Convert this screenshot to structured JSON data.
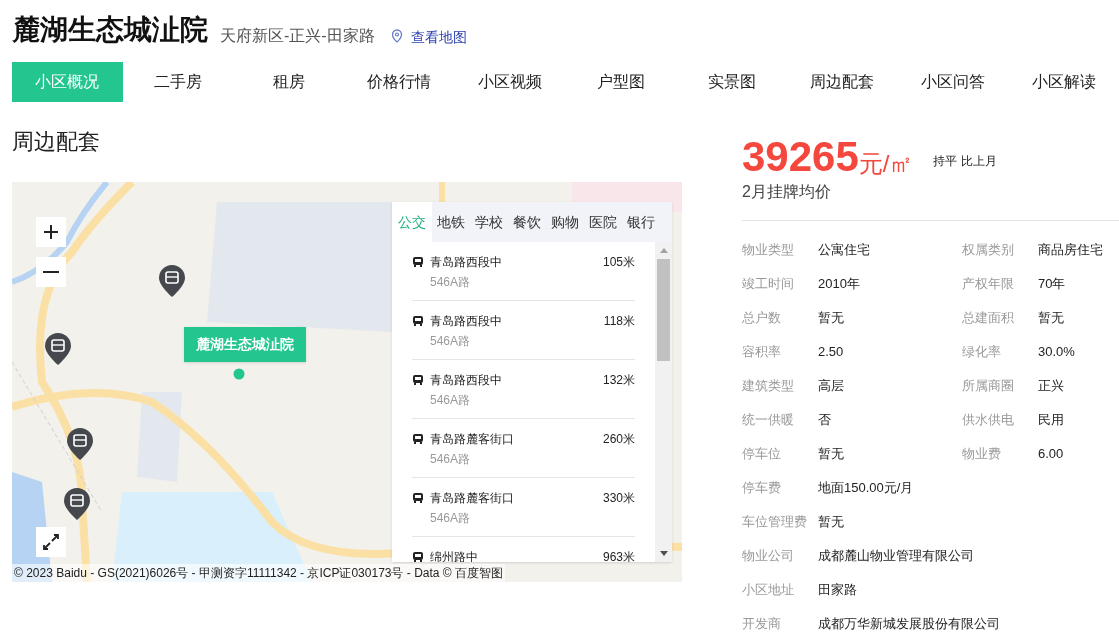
{
  "header": {
    "title": "麓湖生态城沚院",
    "location": "天府新区-正兴-田家路",
    "map_link": "查看地图"
  },
  "tabs": [
    {
      "label": "小区概况",
      "selected": true
    },
    {
      "label": "二手房",
      "selected": false
    },
    {
      "label": "租房",
      "selected": false
    },
    {
      "label": "价格行情",
      "selected": false
    },
    {
      "label": "小区视频",
      "selected": false
    },
    {
      "label": "户型图",
      "selected": false
    },
    {
      "label": "实景图",
      "selected": false
    },
    {
      "label": "周边配套",
      "selected": false
    },
    {
      "label": "小区问答",
      "selected": false
    },
    {
      "label": "小区解读",
      "selected": false
    }
  ],
  "section_title": "周边配套",
  "map": {
    "marker_label": "麓湖生态城沚院",
    "copyright": "© 2023 Baidu - GS(2021)6026号 - 甲测资字11111342 - 京ICP证030173号 - Data © 百度智图",
    "poi_tabs": [
      {
        "label": "公交",
        "selected": true
      },
      {
        "label": "地铁",
        "selected": false
      },
      {
        "label": "学校",
        "selected": false
      },
      {
        "label": "餐饮",
        "selected": false
      },
      {
        "label": "购物",
        "selected": false
      },
      {
        "label": "医院",
        "selected": false
      },
      {
        "label": "银行",
        "selected": false
      }
    ],
    "stops": [
      {
        "name": "青岛路西段中",
        "distance": "105米",
        "line": "546A路"
      },
      {
        "name": "青岛路西段中",
        "distance": "118米",
        "line": "546A路"
      },
      {
        "name": "青岛路西段中",
        "distance": "132米",
        "line": "546A路"
      },
      {
        "name": "青岛路麓客街口",
        "distance": "260米",
        "line": "546A路"
      },
      {
        "name": "青岛路麓客街口",
        "distance": "330米",
        "line": "546A路"
      },
      {
        "name": "绵州路中",
        "distance": "963米"
      }
    ]
  },
  "price": {
    "value": "39265",
    "unit": "元/㎡",
    "trend": "持平",
    "compare": "比上月",
    "caption": "2月挂牌均价"
  },
  "info": [
    [
      {
        "label": "物业类型",
        "value": "公寓住宅"
      },
      {
        "label": "权属类别",
        "value": "商品房住宅"
      }
    ],
    [
      {
        "label": "竣工时间",
        "value": "2010年"
      },
      {
        "label": "产权年限",
        "value": "70年"
      }
    ],
    [
      {
        "label": "总户数",
        "value": "暂无"
      },
      {
        "label": "总建面积",
        "value": "暂无"
      }
    ],
    [
      {
        "label": "容积率",
        "value": "2.50"
      },
      {
        "label": "绿化率",
        "value": "30.0%"
      }
    ],
    [
      {
        "label": "建筑类型",
        "value": "高层"
      },
      {
        "label": "所属商圈",
        "value": "正兴"
      }
    ],
    [
      {
        "label": "统一供暖",
        "value": "否"
      },
      {
        "label": "供水供电",
        "value": "民用"
      }
    ],
    [
      {
        "label": "停车位",
        "value": "暂无"
      },
      {
        "label": "物业费",
        "value": "6.00"
      }
    ],
    [
      {
        "label": "停车费",
        "value": "地面150.00元/月"
      }
    ],
    [
      {
        "label": "车位管理费",
        "value": "暂无"
      }
    ],
    [
      {
        "label": "物业公司",
        "value": "成都麓山物业管理有限公司"
      }
    ],
    [
      {
        "label": "小区地址",
        "value": "田家路"
      }
    ],
    [
      {
        "label": "开发商",
        "value": "成都万华新城发展股份有限公司"
      }
    ]
  ]
}
